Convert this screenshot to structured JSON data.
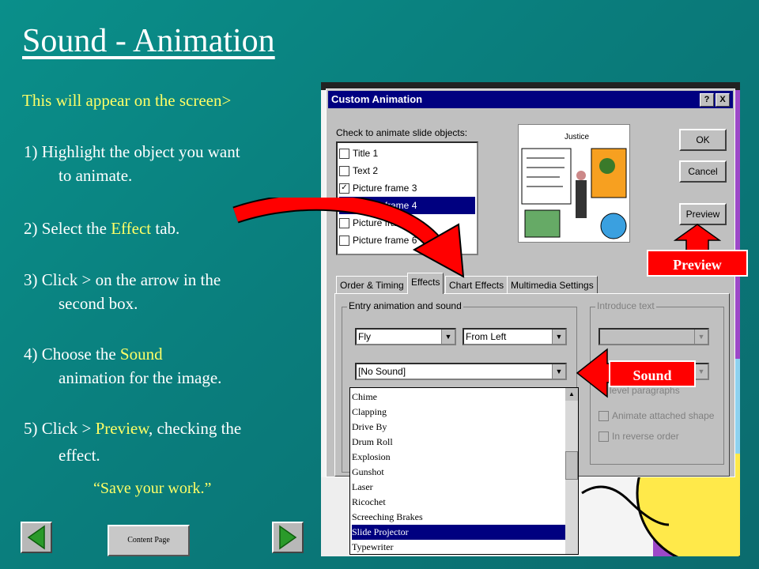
{
  "slide": {
    "title": "Sound - Animation",
    "intro": "This will appear on the screen>",
    "steps": {
      "s1a": "1)  Highlight the object you want",
      "s1b": "to animate.",
      "s2a": "2)   Select the ",
      "s2b": "Effect",
      "s2c": " tab.",
      "s3a": "3)   Click  > on the arrow in the",
      "s3b": "second box.",
      "s4a": "4)    Choose the ",
      "s4b": "Sound",
      "s4c": "animation for the image.",
      "s5a": "5)   Click > ",
      "s5b": "Preview",
      "s5c": ", checking the",
      "s5d": "effect."
    },
    "save_note": "“Save your work.”",
    "content_page_label": "Content Page"
  },
  "dialog": {
    "title": "Custom Animation",
    "help": "?",
    "close": "X",
    "check_label": "Check to animate slide objects:",
    "objects": [
      "Title 1",
      "Text 2",
      "Picture frame 3",
      "Picture frame 4",
      "Picture frame 5",
      "Picture frame 6"
    ],
    "preview_caption": "Justice",
    "buttons": {
      "ok": "OK",
      "cancel": "Cancel",
      "preview": "Preview"
    },
    "tabs": [
      "Order & Timing",
      "Effects",
      "Chart Effects",
      "Multimedia Settings"
    ],
    "entry_group": "Entry animation and sound",
    "effect_value": "Fly",
    "direction_value": "From Left",
    "sound_value": "[No Sound]",
    "introduce_group": "Introduce text",
    "level_paragraphs": "level paragraphs",
    "animate_attached": "Animate attached shape",
    "reverse_order": "In reverse order",
    "sounds": [
      "Chime",
      "Clapping",
      "Drive By",
      "Drum Roll",
      "Explosion",
      "Gunshot",
      "Laser",
      "Ricochet",
      "Screeching Brakes",
      "Slide Projector",
      "Typewriter"
    ]
  },
  "callouts": {
    "preview": "Preview",
    "sound": "Sound"
  },
  "colors": {
    "background": "#0a8f8a",
    "highlight": "#ffff66",
    "callout": "#ff0000",
    "titlebar": "#000080"
  }
}
